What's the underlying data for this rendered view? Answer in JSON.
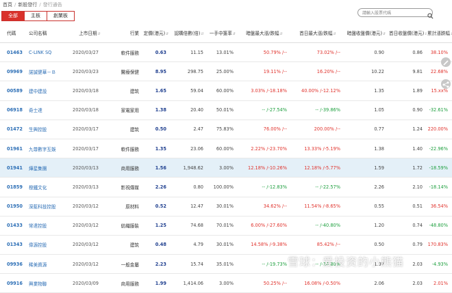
{
  "breadcrumb": {
    "home": "首頁",
    "section": "新股發行",
    "current": "發行通告"
  },
  "tabs": [
    {
      "label": "全部",
      "active": true
    },
    {
      "label": "主板",
      "active": false
    },
    {
      "label": "創業板",
      "active": false
    }
  ],
  "search": {
    "placeholder": "請輸入股票代碼"
  },
  "columns": [
    "代碼",
    "公司名稱",
    "上市日期",
    "行業",
    "定價(港元)",
    "認購倍數(倍)",
    "一手中簽率",
    "暗盤最大漲/跌幅",
    "首日最大漲/跌幅",
    "暗盤收盤價(港元)",
    "首日收盤價(港元)",
    "累計漲跌幅"
  ],
  "rows": [
    {
      "code": "01463",
      "name": "C-LINK SQ",
      "date": "2020/03/27",
      "industry": "軟件服務",
      "price": "0.63",
      "sub": "11.15",
      "ratio": "13.01%",
      "dark": "50.79% /--",
      "dark_c": "red",
      "first": "73.02% /--",
      "first_c": "red",
      "dark_close": "0.90",
      "first_close": "0.86",
      "cum": "38.10%",
      "cum_c": "red"
    },
    {
      "code": "09969",
      "name": "諾誠健華－Ｂ",
      "date": "2020/03/23",
      "industry": "醫療保健",
      "price": "8.95",
      "sub": "298.75",
      "ratio": "25.00%",
      "dark": "19.11% /--",
      "dark_c": "red",
      "first": "16.20% /--",
      "first_c": "red",
      "dark_close": "10.22",
      "first_close": "9.81",
      "cum": "22.68%",
      "cum_c": "red"
    },
    {
      "code": "00589",
      "name": "建中建設",
      "date": "2020/03/18",
      "industry": "建筑",
      "price": "1.65",
      "sub": "59.04",
      "ratio": "60.00%",
      "dark": "3.03% /-18.18%",
      "dark_c": "mixed",
      "first": "40.00% /-12.12%",
      "first_c": "mixed",
      "dark_close": "1.35",
      "first_close": "1.89",
      "cum": "15.xx%",
      "cum_c": "red"
    },
    {
      "code": "06918",
      "name": "奇士達",
      "date": "2020/03/18",
      "industry": "家電家用",
      "price": "1.38",
      "sub": "20.40",
      "ratio": "50.01%",
      "dark": "-- /-27.54%",
      "dark_c": "green",
      "first": "-- /-39.86%",
      "first_c": "green",
      "dark_close": "1.05",
      "first_close": "0.90",
      "cum": "-32.61%",
      "cum_c": "green"
    },
    {
      "code": "01472",
      "name": "生興控股",
      "date": "2020/03/17",
      "industry": "建筑",
      "price": "0.50",
      "sub": "2.47",
      "ratio": "75.83%",
      "dark": "76.00% /--",
      "dark_c": "red",
      "first": "200.00% /--",
      "first_c": "red",
      "dark_close": "0.77",
      "first_close": "1.24",
      "cum": "220.00%",
      "cum_c": "red"
    },
    {
      "code": "01961",
      "name": "九尊數字互娛",
      "date": "2020/03/17",
      "industry": "軟件服務",
      "price": "1.35",
      "sub": "23.06",
      "ratio": "60.00%",
      "dark": "2.22% /-23.70%",
      "dark_c": "mixed",
      "first": "13.33% /-5.19%",
      "first_c": "mixed",
      "dark_close": "1.38",
      "first_close": "1.40",
      "cum": "-22.96%",
      "cum_c": "green"
    },
    {
      "code": "01941",
      "name": "燁星集團",
      "date": "2020/03/13",
      "industry": "商用服務",
      "price": "1.56",
      "sub": "1,948.62",
      "ratio": "3.00%",
      "dark": "12.18% /-10.26%",
      "dark_c": "mixed",
      "first": "12.18% /-5.77%",
      "first_c": "mixed",
      "dark_close": "1.59",
      "first_close": "1.72",
      "cum": "-18.59%",
      "cum_c": "green",
      "hl": true
    },
    {
      "code": "01859",
      "name": "橙鐵文化",
      "date": "2020/03/13",
      "industry": "影視傳媒",
      "price": "2.26",
      "sub": "0.80",
      "ratio": "100.00%",
      "dark": "-- /-12.83%",
      "dark_c": "green",
      "first": "-- /-22.57%",
      "first_c": "green",
      "dark_close": "2.26",
      "first_close": "2.10",
      "cum": "-18.14%",
      "cum_c": "green"
    },
    {
      "code": "01950",
      "name": "深藍科技控股",
      "date": "2020/03/12",
      "industry": "原材料",
      "price": "0.52",
      "sub": "12.47",
      "ratio": "30.01%",
      "dark": "34.62% /--",
      "dark_c": "red",
      "first": "11.54% /-8.65%",
      "first_c": "mixed",
      "dark_close": "0.55",
      "first_close": "0.51",
      "cum": "36.54%",
      "cum_c": "red"
    },
    {
      "code": "01433",
      "name": "常達控股",
      "date": "2020/03/12",
      "industry": "紡織服裝",
      "price": "1.25",
      "sub": "74.68",
      "ratio": "70.01%",
      "dark": "6.00% /-27.60%",
      "dark_c": "mixed",
      "first": "-- /-40.80%",
      "first_c": "green",
      "dark_close": "1.20",
      "first_close": "0.74",
      "cum": "-48.80%",
      "cum_c": "green"
    },
    {
      "code": "01343",
      "name": "偉源控股",
      "date": "2020/03/12",
      "industry": "建筑",
      "price": "0.48",
      "sub": "4.79",
      "ratio": "30.01%",
      "dark": "14.58% /-9.38%",
      "dark_c": "mixed",
      "first": "85.42% /--",
      "first_c": "red",
      "dark_close": "0.50",
      "first_close": "0.79",
      "cum": "170.83%",
      "cum_c": "red"
    },
    {
      "code": "09936",
      "name": "稀美資源",
      "date": "2020/03/12",
      "industry": "一般金屬",
      "price": "2.23",
      "sub": "15.74",
      "ratio": "35.01%",
      "dark": "-- /-19.73%",
      "dark_c": "green",
      "first": "-- /-14.80%",
      "first_c": "green",
      "dark_close": "1.97",
      "first_close": "2.03",
      "cum": "-4.93%",
      "cum_c": "green"
    },
    {
      "code": "09916",
      "name": "興業物聯",
      "date": "2020/03/09",
      "industry": "商用服務",
      "price": "1.99",
      "sub": "1,414.06",
      "ratio": "3.00%",
      "dark": "50.25% /--",
      "dark_c": "red",
      "first": "16.08% /-0.50%",
      "first_c": "mixed",
      "dark_close": "2.06",
      "first_close": "2.03",
      "cum": "2.01%",
      "cum_c": "red"
    }
  ],
  "watermark": "雪球：爱投资的小熊猫",
  "colors": {
    "accent": "#d9312b",
    "link": "#2a6db5",
    "up": "#e0312b",
    "down": "#1b9e3c",
    "highlight_row": "#e4f0f8"
  }
}
